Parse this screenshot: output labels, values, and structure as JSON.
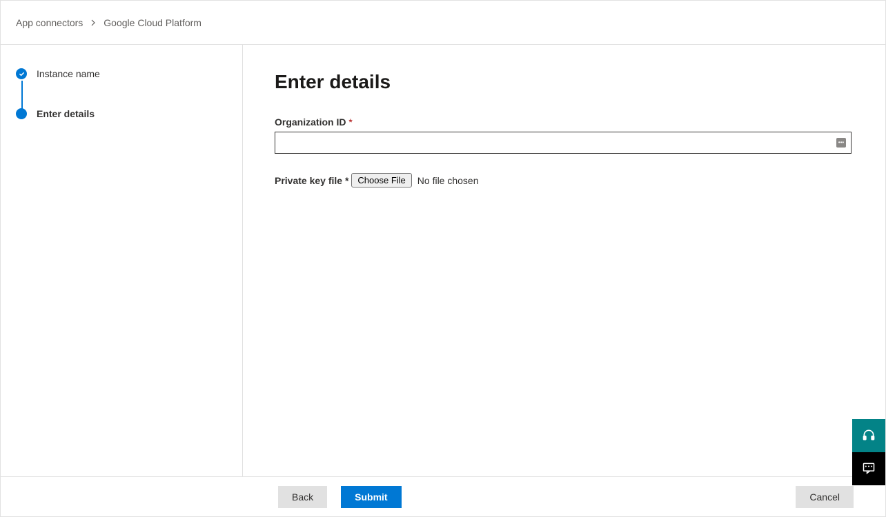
{
  "breadcrumb": {
    "parent": "App connectors",
    "current": "Google Cloud Platform"
  },
  "sidebar": {
    "steps": [
      {
        "label": "Instance name",
        "state": "completed"
      },
      {
        "label": "Enter details",
        "state": "current"
      }
    ]
  },
  "main": {
    "title": "Enter details",
    "org_id": {
      "label": "Organization ID",
      "required_marker": "*",
      "value": ""
    },
    "private_key": {
      "label": "Private key file",
      "required_marker": "*",
      "button_label": "Choose File",
      "status_text": "No file chosen"
    }
  },
  "footer": {
    "back_label": "Back",
    "submit_label": "Submit",
    "cancel_label": "Cancel"
  }
}
